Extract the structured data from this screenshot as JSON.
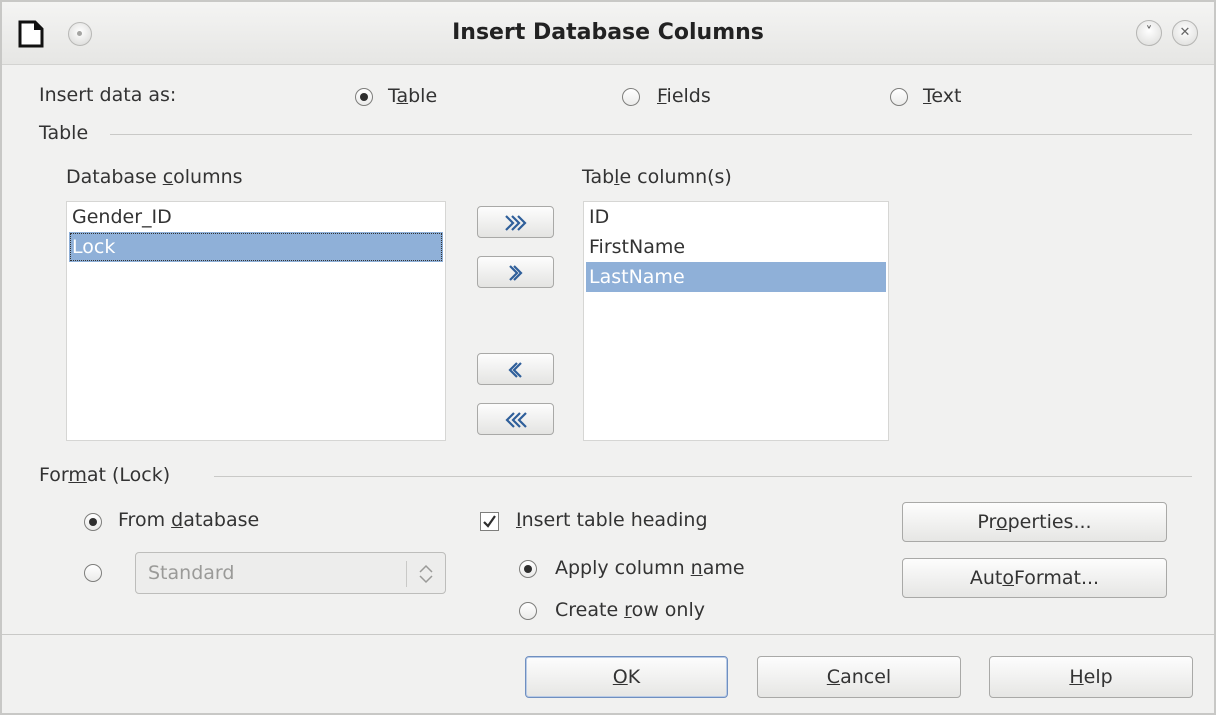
{
  "window": {
    "title": "Insert Database Columns"
  },
  "insert_as": {
    "label": "Insert data as:",
    "options": [
      {
        "pre": "T",
        "key": "a",
        "post": "ble",
        "checked": true
      },
      {
        "pre": "",
        "key": "F",
        "post": "ields",
        "checked": false
      },
      {
        "pre": "",
        "key": "T",
        "post": "ext",
        "checked": false
      }
    ]
  },
  "table_section": {
    "title": "Table",
    "db_columns_label": {
      "pre": "Database ",
      "key": "c",
      "post": "olumns"
    },
    "table_columns_label": {
      "pre": "Tab",
      "key": "l",
      "post": "e column(s)"
    },
    "db_columns": [
      {
        "text": "Gender_ID",
        "selected": false
      },
      {
        "text": "Lock",
        "selected": true
      }
    ],
    "table_columns": [
      {
        "text": "ID",
        "selected": false
      },
      {
        "text": "FirstName",
        "selected": false
      },
      {
        "text": "LastName",
        "selected": true
      }
    ]
  },
  "format_section": {
    "title": {
      "pre": "For",
      "key": "m",
      "post": "at (Lock)"
    },
    "from_database": {
      "pre": "From ",
      "key": "d",
      "post": "atabase",
      "checked": true
    },
    "format_combo": {
      "value": "Standard",
      "checked": false
    },
    "insert_heading": {
      "pre": "",
      "key": "I",
      "post": "nsert table heading",
      "checked": true
    },
    "apply_column_name": {
      "pre": "Apply column ",
      "key": "n",
      "post": "ame",
      "checked": true
    },
    "create_row_only": {
      "pre": "Create ",
      "key": "r",
      "post": "ow only",
      "checked": false
    },
    "properties_button": {
      "pre": "Pr",
      "key": "o",
      "post": "perties..."
    },
    "autoformat_button": {
      "pre": "Aut",
      "key": "o",
      "post": "Format..."
    }
  },
  "footer": {
    "ok": {
      "pre": "",
      "key": "O",
      "post": "K"
    },
    "cancel": {
      "pre": "",
      "key": "C",
      "post": "ancel"
    },
    "help": {
      "pre": "",
      "key": "H",
      "post": "elp"
    }
  },
  "colors": {
    "dialog_bg": "#f1f1f0",
    "selection": "#8fb0d8",
    "arrow_blue": "#2f5f9a"
  }
}
